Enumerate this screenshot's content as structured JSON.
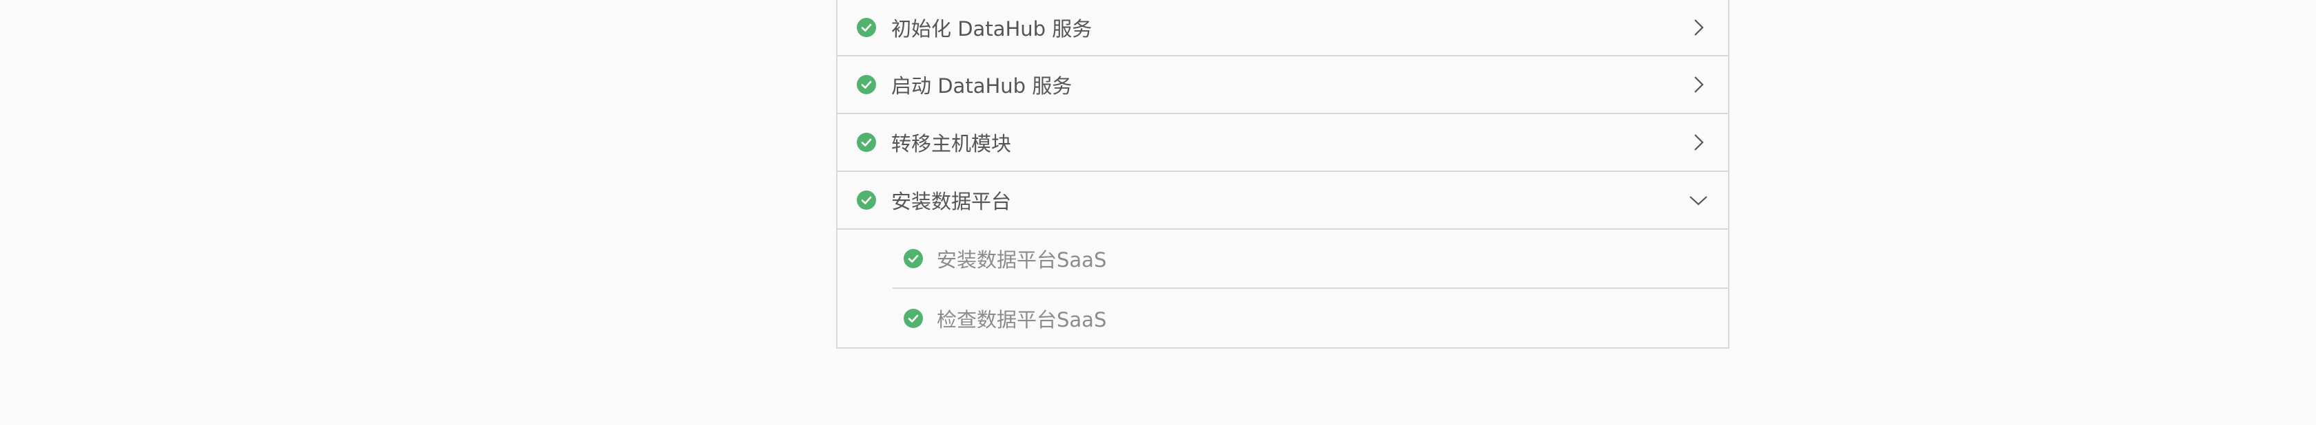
{
  "colors": {
    "success": "#52b36f",
    "text_primary": "#555555",
    "text_secondary": "#8c8c8c",
    "border": "#d9d9d9"
  },
  "steps": [
    {
      "label": "初始化 DataHub 服务",
      "status": "success-icon",
      "chevron": "chevron-right-icon"
    },
    {
      "label": "启动 DataHub 服务",
      "status": "success-icon",
      "chevron": "chevron-right-icon"
    },
    {
      "label": "转移主机模块",
      "status": "success-icon",
      "chevron": "chevron-right-icon"
    },
    {
      "label": "安装数据平台",
      "status": "success-icon",
      "chevron": "chevron-down-icon"
    }
  ],
  "substeps": [
    {
      "label": "安装数据平台SaaS",
      "status": "success-icon"
    },
    {
      "label": "检查数据平台SaaS",
      "status": "success-icon"
    }
  ]
}
